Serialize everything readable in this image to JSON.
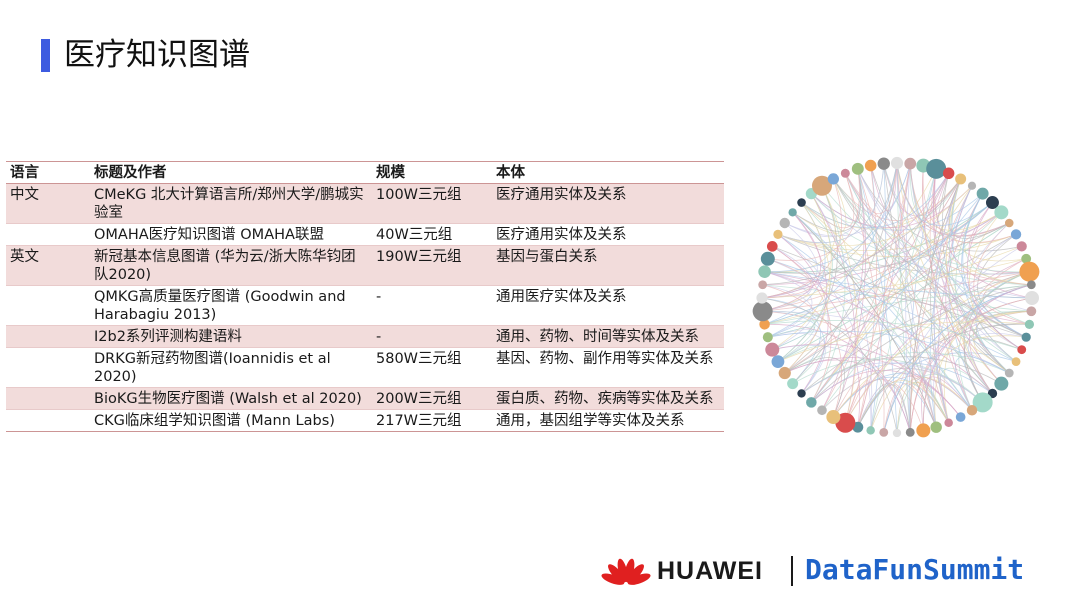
{
  "slide": {
    "title": "医疗知识图谱"
  },
  "table": {
    "headers": [
      "语言",
      "标题及作者",
      "规模",
      "本体"
    ],
    "rows": [
      {
        "lang": "中文",
        "title": "CMeKG 北大计算语言所/郑州大学/鹏城实验室",
        "scale": "100W三元组",
        "ontology": "医疗通用实体及关系"
      },
      {
        "lang": "",
        "title": "OMAHA医疗知识图谱 OMAHA联盟",
        "scale": "40W三元组",
        "ontology": "医疗通用实体及关系"
      },
      {
        "lang": "英文",
        "title": "新冠基本信息图谱 (华为云/浙大陈华钧团队2020)",
        "scale": "190W三元组",
        "ontology": "基因与蛋白关系"
      },
      {
        "lang": "",
        "title": "QMKG高质量医疗图谱 (Goodwin and Harabagiu 2013)",
        "scale": "-",
        "ontology": "通用医疗实体及关系"
      },
      {
        "lang": "",
        "title": "I2b2系列评测构建语料",
        "scale": "-",
        "ontology": "通用、药物、时间等实体及关系"
      },
      {
        "lang": "",
        "title": "DRKG新冠药物图谱(Ioannidis et al 2020)",
        "scale": "580W三元组",
        "ontology": "基因、药物、副作用等实体及关系"
      },
      {
        "lang": "",
        "title": "BioKG生物医疗图谱 (Walsh et al 2020)",
        "scale": "200W三元组",
        "ontology": "蛋白质、药物、疾病等实体及关系"
      },
      {
        "lang": "",
        "title": "CKG临床组学知识图谱 (Mann Labs)",
        "scale": "217W三元组",
        "ontology": "通用，基因组学等实体及关系"
      }
    ]
  },
  "graph": {
    "node_colors": [
      "#e0e0e0",
      "#c9a6a6",
      "#8fc7b5",
      "#5a8f9a",
      "#d94c4c",
      "#e8c07a",
      "#b5b5b5",
      "#6fa8a8",
      "#2c3e50",
      "#a3d9c9",
      "#d7a77a",
      "#7aa7d7",
      "#cc8899",
      "#9fbf7f",
      "#f0a050",
      "#8a8a8a"
    ],
    "edge_colors": [
      "#e8b7b7",
      "#b7dccf",
      "#c9c9e8",
      "#e8d8a8",
      "#a8c8e8",
      "#d8a8c8",
      "#b8b8b8"
    ]
  },
  "footer": {
    "brand": "HUAWEI",
    "summit": "DataFunSummit",
    "logo_color": "#e02020"
  }
}
